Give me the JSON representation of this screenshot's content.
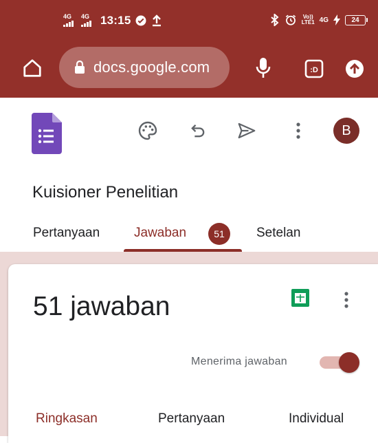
{
  "status_bar": {
    "network_1": "4G",
    "network_2": "4G",
    "time": "13:15",
    "volte_1": "Vo))",
    "volte_2": "LTE1",
    "network_right": "4G",
    "battery": "24"
  },
  "browser": {
    "url": "docs.google.com"
  },
  "form": {
    "title": "Kuisioner Penelitian",
    "avatar_letter": "B",
    "tabs": [
      {
        "label": "Pertanyaan"
      },
      {
        "label": "Jawaban",
        "badge": "51"
      },
      {
        "label": "Setelan"
      }
    ],
    "active_tab": "Jawaban"
  },
  "responses": {
    "count_text": "51 jawaban",
    "accepting_label": "Menerima jawaban",
    "accepting": true,
    "subtabs": [
      {
        "label": "Ringkasan"
      },
      {
        "label": "Pertanyaan"
      },
      {
        "label": "Individual"
      }
    ],
    "active_subtab": "Ringkasan"
  },
  "colors": {
    "status_bar_bg": "#93302a",
    "accent": "#8c2e28",
    "forms_purple": "#7248b9",
    "sheets_green": "#0f9d58",
    "card_band": "#ecd8d6"
  },
  "icons": [
    "home-icon",
    "lock-icon",
    "mic-icon",
    "tab-switcher-icon",
    "upload-icon",
    "forms-logo-icon",
    "palette-icon",
    "undo-icon",
    "send-icon",
    "more-vert-icon",
    "sheets-icon"
  ]
}
